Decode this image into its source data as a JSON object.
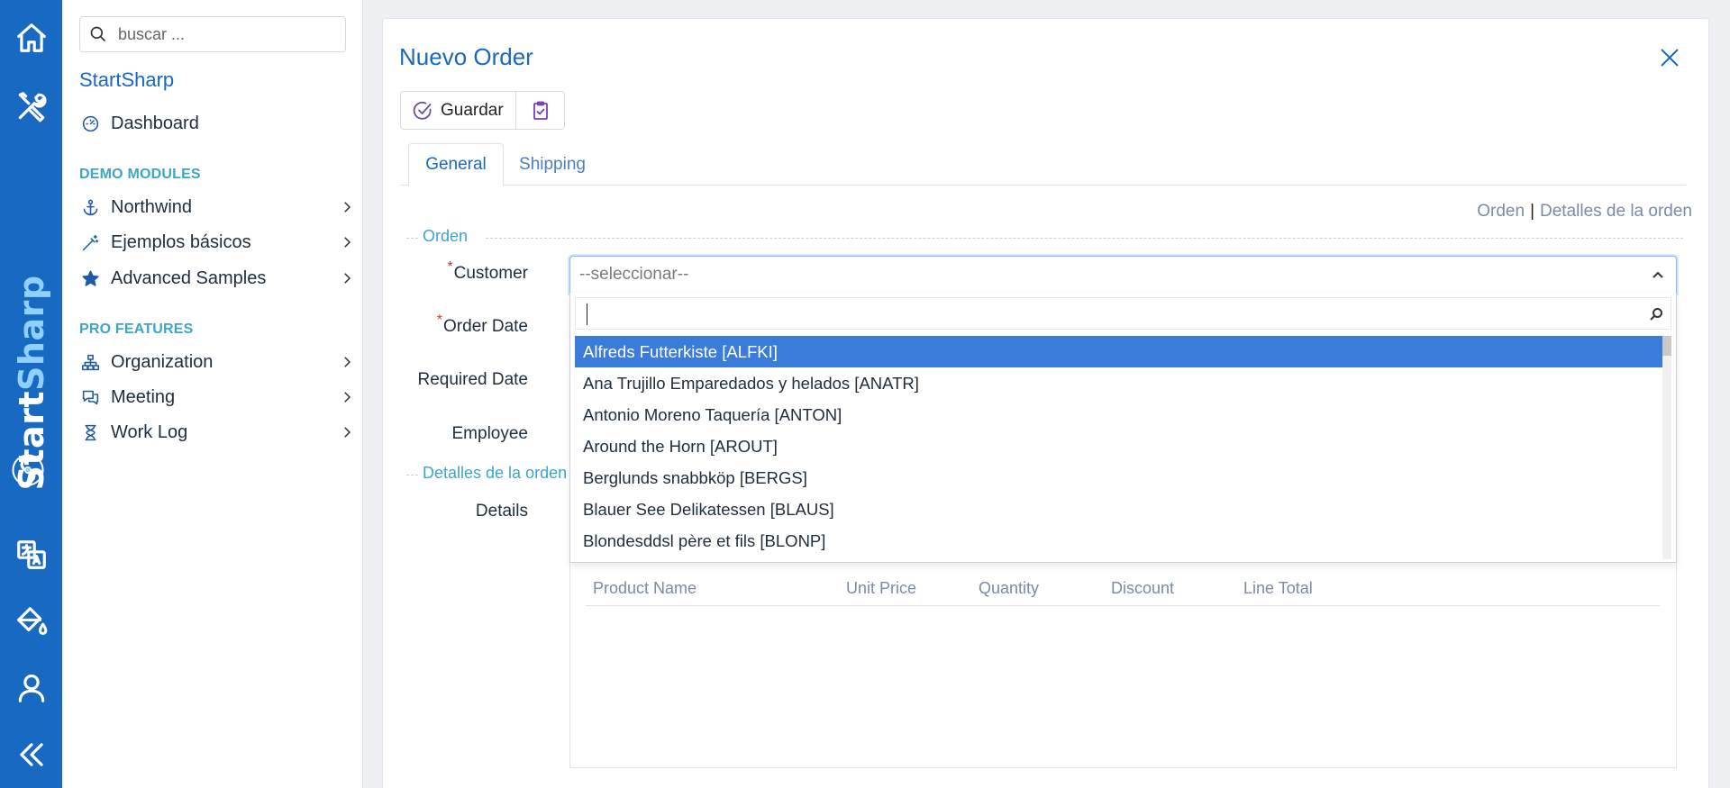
{
  "rail": {
    "brand_start": "Start",
    "brand_end": "Sharp",
    "items": [
      {
        "icon": "home-icon"
      },
      {
        "icon": "tools-icon"
      },
      {
        "icon": "translate-icon"
      },
      {
        "icon": "paint-bucket-icon"
      },
      {
        "icon": "user-icon"
      },
      {
        "icon": "collapse-double-chevron-icon"
      }
    ]
  },
  "sidebar": {
    "search_placeholder": "buscar ...",
    "brand": "StartSharp",
    "dashboard": "Dashboard",
    "section_demo": "DEMO MODULES",
    "northwind": "Northwind",
    "ejemplos": "Ejemplos básicos",
    "advanced": "Advanced Samples",
    "section_pro": "PRO FEATURES",
    "organization": "Organization",
    "meeting": "Meeting",
    "worklog": "Work Log"
  },
  "dialog": {
    "title": "Nuevo Order",
    "save_label": "Guardar",
    "tabs": {
      "general": "General",
      "shipping": "Shipping"
    },
    "links": {
      "orden": "Orden",
      "sep": "|",
      "detalles": "Detalles de la orden"
    },
    "categories": {
      "orden": "Orden",
      "detalles": "Detalles de la orden"
    },
    "fields": {
      "customer": "Customer",
      "order_date": "Order Date",
      "required_date": "Required Date",
      "employee": "Employee",
      "details": "Details",
      "required_mark": "*"
    },
    "customer_select": {
      "value": "--seleccionar--",
      "search_value": "",
      "options": [
        "Alfreds Futterkiste [ALFKI]",
        "Ana Trujillo Emparedados y helados [ANATR]",
        "Antonio Moreno Taquería [ANTON]",
        "Around the Horn [AROUT]",
        "Berglunds snabbköp [BERGS]",
        "Blauer See Delikatessen [BLAUS]",
        "Blondesddsl père et fils [BLONP]"
      ],
      "highlighted_index": 0
    },
    "details_grid": {
      "columns": [
        "Product Name",
        "Unit Price",
        "Quantity",
        "Discount",
        "Line Total"
      ]
    }
  },
  "colors": {
    "rail": "#1769c1",
    "accent": "#1769c1",
    "section": "#3da6c6",
    "highlight": "#3b7bd9",
    "required": "#d9342b"
  }
}
